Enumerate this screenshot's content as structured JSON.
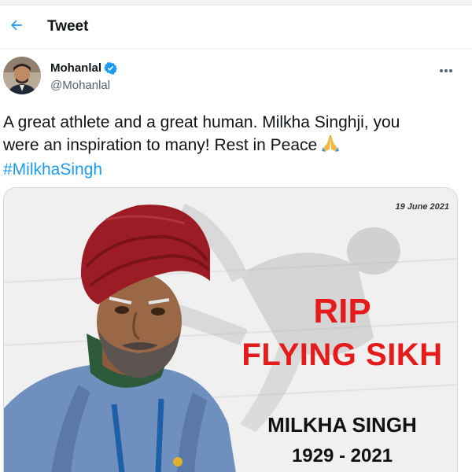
{
  "header": {
    "title": "Tweet",
    "back_icon": "arrow-left-icon"
  },
  "author": {
    "display_name": "Mohanlal",
    "handle": "@Mohanlal",
    "verified": true,
    "more_icon": "more-horizontal-icon"
  },
  "tweet": {
    "line1": "A great athlete and a great human. Milkha Singhji, you",
    "line2": "were an inspiration to many! Rest in Peace",
    "emoji": "folded-hands",
    "hashtag": "#MilkhaSingh"
  },
  "media": {
    "date": "19 June 2021",
    "headline_line1": "RIP",
    "headline_line2": "FLYING SIKH",
    "name": "MILKHA SINGH",
    "years": "1929 - 2021"
  },
  "colors": {
    "accent": "#1d9bf0",
    "headline_red": "#e51b1b",
    "turban": "#9b1c24"
  }
}
